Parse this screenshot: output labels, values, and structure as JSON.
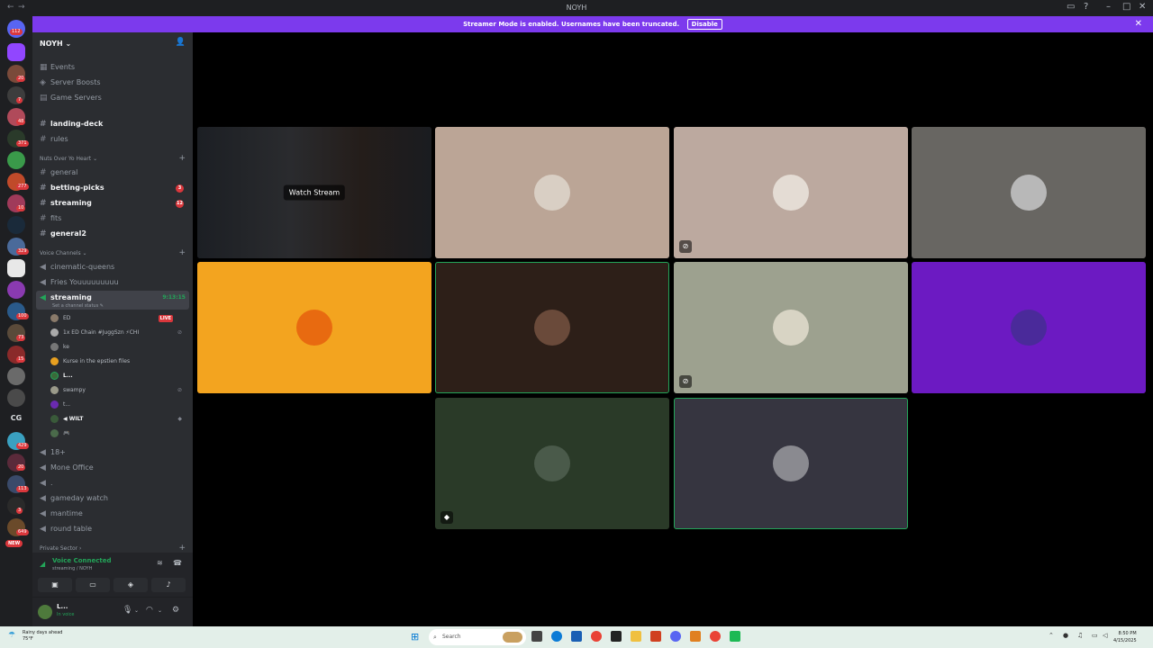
{
  "window": {
    "title": "NOYH",
    "back": "←",
    "fwd": "→"
  },
  "guilds": {
    "home_badge": "112",
    "badges": [
      "20",
      "7",
      "48",
      "371",
      "277",
      "10",
      "329",
      "100",
      "73",
      "15",
      "429",
      "20",
      "113",
      "3",
      "649"
    ],
    "cg_label": "CG",
    "new_label": "NEW"
  },
  "banner": {
    "text": "Streamer Mode is enabled. Usernames have been truncated.",
    "disable": "Disable",
    "close": "✕"
  },
  "server": {
    "name": "NOYH ⌄",
    "top_items": [
      "Events",
      "Server Boosts",
      "Game Servers"
    ],
    "text1": [
      "landing-deck",
      "rules"
    ],
    "cat1": "Nuts Over Yo Heart ⌄",
    "text2": [
      "general",
      "betting-picks",
      "streaming",
      "fits",
      "general2"
    ],
    "badge_betting": "3",
    "badge_streaming": "12",
    "cat2": "Voice Channels ⌄",
    "voice": [
      "cinematic-queens",
      "Fries Youuuuuuuuu",
      "streaming"
    ],
    "stream_time": "9:13:15",
    "channel_status": "Set a channel status ✎",
    "users": [
      "ED",
      "1x ED Chain #JuggSzn ⚡CHI",
      "ke",
      "Kurse in the epstien files",
      "L...",
      "swampy",
      "t...",
      "◀ WILT",
      "🎮"
    ],
    "live": "LIVE",
    "voice2": [
      "18+",
      "Mone Office",
      ".",
      "gameday watch",
      "mantime",
      "round table"
    ],
    "cat3": "Private Sector ›"
  },
  "voice_panel": {
    "status": "Voice Connected",
    "sub": "streaming / NOYH"
  },
  "user_panel": {
    "name": "L...",
    "status": "In voice"
  },
  "stage": {
    "watch_label": "Watch Stream"
  },
  "taskbar": {
    "weather_line1": "Rainy days ahead",
    "weather_line2": "75°F",
    "search": "Search",
    "time": "8:50 PM",
    "date": "4/15/2025"
  }
}
